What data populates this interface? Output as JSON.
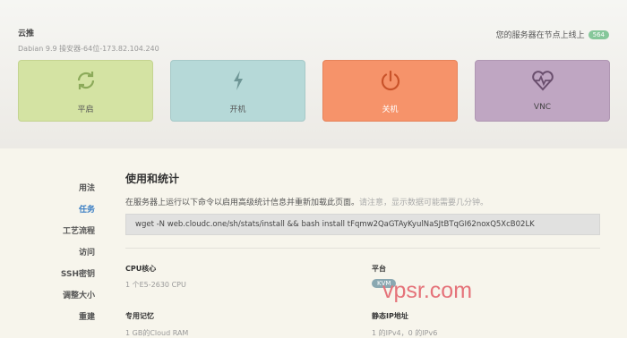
{
  "server": {
    "name": "云推",
    "meta": "Dabian 9.9 操安器-64位-173.82.104.240",
    "status_text": "您的服务器在节点上线上",
    "status_badge": "564"
  },
  "actions": [
    {
      "label": "平启",
      "icon": "restart-icon",
      "color": "#d4e3a3"
    },
    {
      "label": "开机",
      "icon": "lightning-icon",
      "color": "#b6d9d8"
    },
    {
      "label": "关机",
      "icon": "power-icon",
      "color": "#f6936a"
    },
    {
      "label": "VNC",
      "icon": "heart-monitor-icon",
      "color": "#bfa6c2"
    }
  ],
  "sidebar": {
    "items": [
      {
        "label": "用法",
        "active": false
      },
      {
        "label": "任务",
        "active": true
      },
      {
        "label": "工艺流程",
        "active": false
      },
      {
        "label": "访问",
        "active": false
      },
      {
        "label": "SSH密钥",
        "active": false
      },
      {
        "label": "调整大小",
        "active": false
      },
      {
        "label": "重建",
        "active": false
      }
    ]
  },
  "main": {
    "title": "使用和统计",
    "description": "在服务器上运行以下命令以启用高级统计信息并重新加载此页面。",
    "hint": "请注意，显示数据可能需要几分钟。",
    "command": "wget -N web.cloudc.one/sh/stats/install && bash install tFqmw2QaGTAyKyulNaSJtBTqGI62noxQ5XcB02LK",
    "stats": [
      {
        "label": "CPU核心",
        "value": "1 个E5-2630 CPU"
      },
      {
        "label": "平台",
        "value": "KVM"
      },
      {
        "label": "专用记忆",
        "value": "1 GB的Cloud RAM"
      },
      {
        "label": "静态IP地址",
        "value": "1 的IPv4，0 的IPv6"
      }
    ]
  },
  "watermark": "vpsr.com"
}
